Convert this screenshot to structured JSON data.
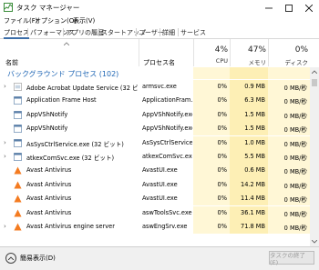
{
  "window": {
    "title": "タスク マネージャー"
  },
  "menu": [
    "ファイル(F)",
    "オプション(O)",
    "表示(V)"
  ],
  "tabs": [
    "プロセス",
    "パフォーマンス",
    "アプリの履歴",
    "スタートアップ",
    "ユーザー",
    "詳細",
    "サービス"
  ],
  "columns": {
    "name": "名前",
    "process_name": "プロセス名",
    "cpu": {
      "pct": "4%",
      "label": "CPU"
    },
    "mem": {
      "pct": "47%",
      "label": "メモリ"
    },
    "disk": {
      "pct": "0%",
      "label": "ディスク"
    }
  },
  "group": {
    "label": "バックグラウンド プロセス (102)"
  },
  "rows": [
    {
      "name": "Adobe Acrobat Update Service (32 ビット)",
      "process": "armsvc.exe",
      "cpu": "0%",
      "mem": "0.9 MB",
      "disk": "0 MB/秒",
      "expand": true,
      "icon": "acrobat-icon"
    },
    {
      "name": "Application Frame Host",
      "process": "ApplicationFram...",
      "cpu": "0%",
      "mem": "6.3 MB",
      "disk": "0 MB/秒",
      "expand": false,
      "icon": "app-window-icon"
    },
    {
      "name": "AppVShNotify",
      "process": "AppVShNotify.exe",
      "cpu": "0%",
      "mem": "1.5 MB",
      "disk": "0 MB/秒",
      "expand": false,
      "icon": "app-window-icon"
    },
    {
      "name": "AppVShNotify",
      "process": "AppVShNotify.exe",
      "cpu": "0%",
      "mem": "1.5 MB",
      "disk": "0 MB/秒",
      "expand": false,
      "icon": "app-window-icon"
    },
    {
      "name": "AsSysCtrlService.exe (32 ビット)",
      "process": "AsSysCtrlService...",
      "cpu": "0%",
      "mem": "1.0 MB",
      "disk": "0 MB/秒",
      "expand": true,
      "icon": "app-window-icon"
    },
    {
      "name": "atkexComSvc.exe (32 ビット)",
      "process": "atkexComSvc.exe",
      "cpu": "0%",
      "mem": "5.5 MB",
      "disk": "0 MB/秒",
      "expand": true,
      "icon": "app-window-icon"
    },
    {
      "name": "Avast Antivirus",
      "process": "AvastUI.exe",
      "cpu": "0%",
      "mem": "0.6 MB",
      "disk": "0 MB/秒",
      "expand": false,
      "icon": "avast-icon"
    },
    {
      "name": "Avast Antivirus",
      "process": "AvastUI.exe",
      "cpu": "0%",
      "mem": "14.2 MB",
      "disk": "0 MB/秒",
      "expand": false,
      "icon": "avast-icon"
    },
    {
      "name": "Avast Antivirus",
      "process": "AvastUI.exe",
      "cpu": "0%",
      "mem": "11.4 MB",
      "disk": "0 MB/秒",
      "expand": false,
      "icon": "avast-icon"
    },
    {
      "name": "Avast Antivirus",
      "process": "aswToolsSvc.exe",
      "cpu": "0%",
      "mem": "36.1 MB",
      "disk": "0 MB/秒",
      "expand": false,
      "icon": "avast-icon"
    },
    {
      "name": "Avast Antivirus engine server",
      "process": "aswEngSrv.exe",
      "cpu": "0%",
      "mem": "71.8 MB",
      "disk": "0 MB/秒",
      "expand": true,
      "icon": "avast-icon"
    }
  ],
  "footer": {
    "fewer_details": "簡易表示(D)",
    "end_task": "タスクの終了(E)"
  },
  "colors": {
    "cpu_bg": "#fff7d6",
    "mem_bg": "#fdefb5",
    "disk_bg": "#fff7d6",
    "group_text": "#1f66b5",
    "avast_orange": "#f47b20"
  }
}
